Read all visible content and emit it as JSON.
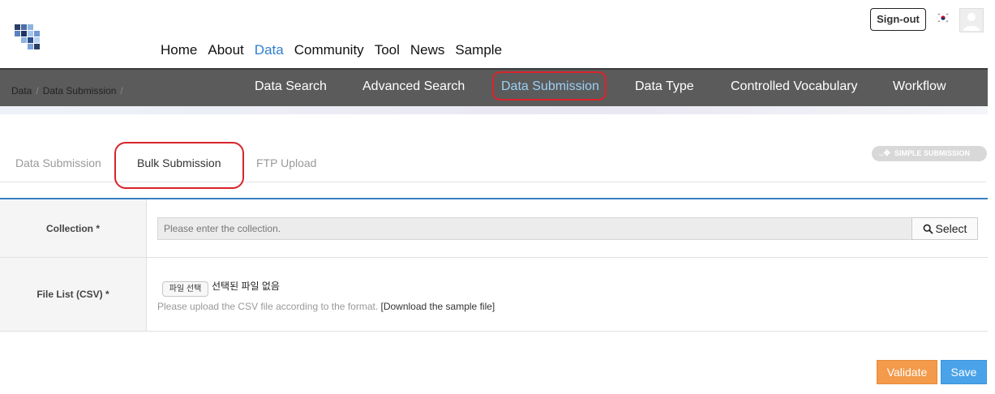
{
  "header": {
    "nav": [
      "Home",
      "About",
      "Data",
      "Community",
      "Tool",
      "News",
      "Sample"
    ],
    "active_nav": "Data",
    "signout_label": "Sign-out",
    "flag_icon": "korea-flag-icon",
    "avatar_icon": "user-avatar-icon"
  },
  "subnav": {
    "breadcrumb": [
      "Data",
      "Data Submission"
    ],
    "items": [
      "Data Search",
      "Advanced Search",
      "Data Submission",
      "Data Type",
      "Controlled Vocabulary",
      "Workflow"
    ],
    "active": "Data Submission"
  },
  "tabs": {
    "items": [
      "Data Submission",
      "Bulk Submission",
      "FTP Upload"
    ],
    "active": "Bulk Submission",
    "simple_submission_label": "SIMPLE SUBMISSION"
  },
  "form": {
    "collection_label": "Collection *",
    "collection_placeholder": "Please enter the collection.",
    "select_label": "Select",
    "file_list_label": "File List (CSV) *",
    "file_button_label": "파일 선택",
    "no_file_text": "선택된 파일 없음",
    "help_text": "Please upload the CSV file according to the format.",
    "sample_link": "[Download the sample file]"
  },
  "actions": {
    "validate_label": "Validate",
    "save_label": "Save"
  },
  "colors": {
    "accent": "#2f7fd0",
    "subbar": "#5b5b5b",
    "highlight": "#d8232a",
    "validate": "#f39a4b",
    "save": "#4aa3e8"
  }
}
